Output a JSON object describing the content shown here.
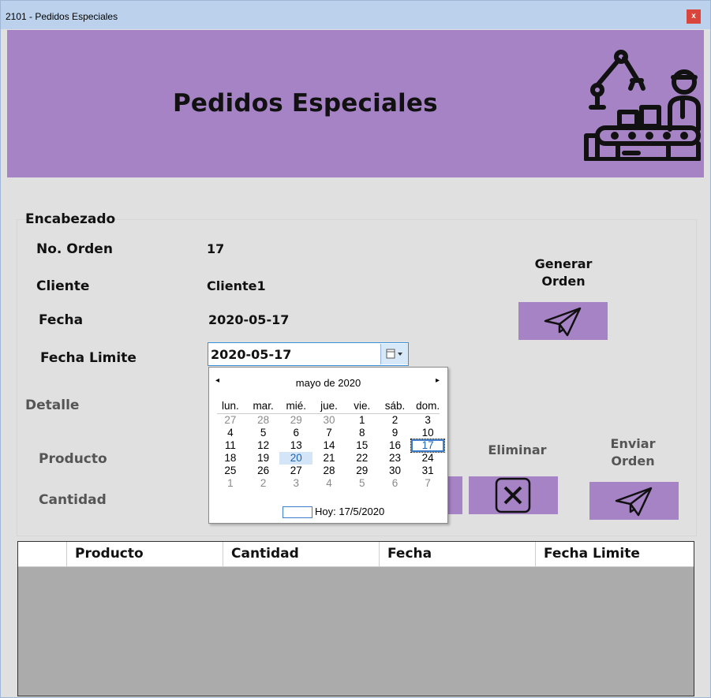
{
  "window": {
    "title": "2101 - Pedidos Especiales",
    "close_glyph": "x"
  },
  "banner": {
    "title": "Pedidos Especiales",
    "icon": "factory-worker-conveyor-icon"
  },
  "encabezado": {
    "heading": "Encabezado",
    "no_orden_label": "No. Orden",
    "no_orden_value": "17",
    "cliente_label": "Cliente",
    "cliente_value": "Cliente1",
    "fecha_label": "Fecha",
    "fecha_value": "2020-05-17",
    "fecha_limite_label": "Fecha Limite",
    "fecha_limite_value": "2020-05-17"
  },
  "generar": {
    "line1": "Generar",
    "line2": "Orden",
    "icon": "paper-plane-icon"
  },
  "detalle": {
    "heading": "Detalle",
    "producto_label": "Producto",
    "cantidad_label": "Cantidad"
  },
  "eliminar": {
    "label": "Eliminar",
    "icon": "x-box-icon"
  },
  "enviar": {
    "line1": "Enviar",
    "line2": "Orden",
    "icon": "paper-plane-icon"
  },
  "calendar": {
    "month_label": "mayo de 2020",
    "prev": "◂",
    "next": "▸",
    "weekdays": [
      "lun.",
      "mar.",
      "mié.",
      "jue.",
      "vie.",
      "sáb.",
      "dom."
    ],
    "weeks": [
      [
        "27",
        "28",
        "29",
        "30",
        "1",
        "2",
        "3"
      ],
      [
        "4",
        "5",
        "6",
        "7",
        "8",
        "9",
        "10"
      ],
      [
        "11",
        "12",
        "13",
        "14",
        "15",
        "16",
        "17"
      ],
      [
        "18",
        "19",
        "20",
        "21",
        "22",
        "23",
        "24"
      ],
      [
        "25",
        "26",
        "27",
        "28",
        "29",
        "30",
        "31"
      ],
      [
        "1",
        "2",
        "3",
        "4",
        "5",
        "6",
        "7"
      ]
    ],
    "today_text": "Hoy: 17/5/2020"
  },
  "grid": {
    "columns": [
      "Producto",
      "Cantidad",
      "Fecha",
      "Fecha Limite"
    ],
    "rows": []
  },
  "colors": {
    "accent": "#a683c5",
    "grid_bg": "#ababab",
    "titlebar": "#bcd2ec"
  }
}
